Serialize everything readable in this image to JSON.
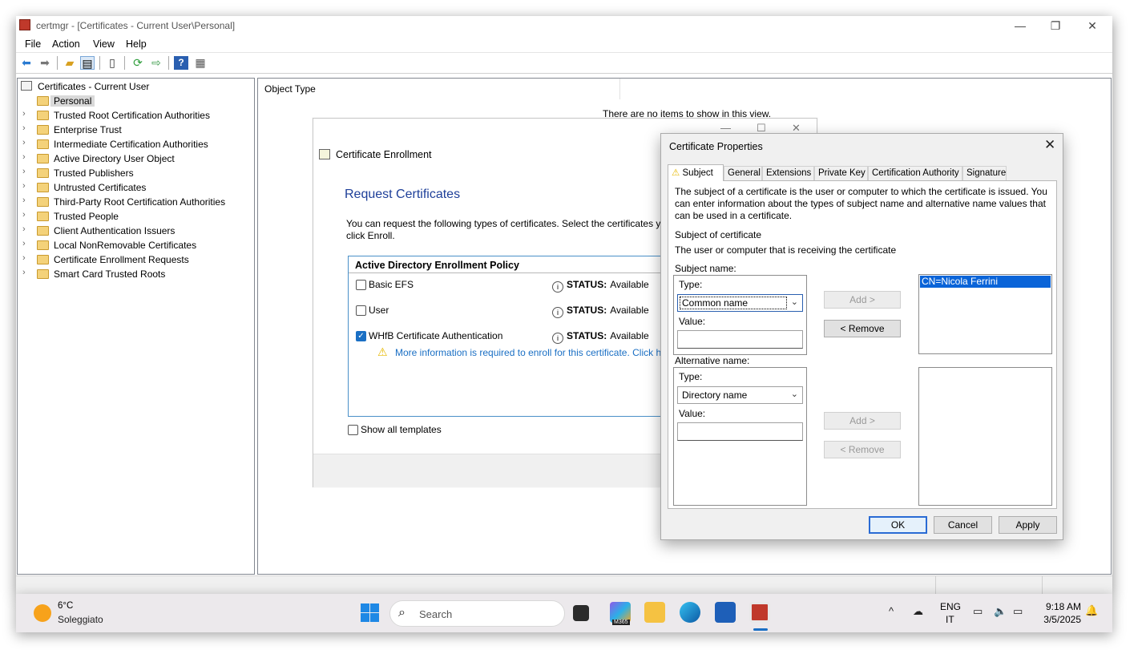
{
  "window": {
    "title": "certmgr - [Certificates - Current User\\Personal]",
    "minimize_glyph": "—",
    "restore_glyph": "❐",
    "close_glyph": "✕"
  },
  "menu": {
    "file": "File",
    "action": "Action",
    "view": "View",
    "help": "Help"
  },
  "toolbar_icons": [
    "back-icon",
    "forward-icon",
    "up-folder-icon",
    "show-hide-tree-icon",
    "clipboard-icon",
    "refresh-icon",
    "export-icon",
    "help-icon",
    "console-tree-icon"
  ],
  "tree": {
    "root": "Certificates - Current User",
    "items": [
      "Personal",
      "Trusted Root Certification Authorities",
      "Enterprise Trust",
      "Intermediate Certification Authorities",
      "Active Directory User Object",
      "Trusted Publishers",
      "Untrusted Certificates",
      "Third-Party Root Certification Authorities",
      "Trusted People",
      "Client Authentication Issuers",
      "Local NonRemovable Certificates",
      "Certificate Enrollment Requests",
      "Smart Card Trusted Roots"
    ]
  },
  "list": {
    "column": "Object Type",
    "empty": "There are no items to show in this view."
  },
  "enroll": {
    "title": "Certificate Enrollment",
    "heading": "Request Certificates",
    "description": "You can request the following types of certificates. Select the certificates yo",
    "description2": "click Enroll.",
    "policy": "Active Directory Enrollment Policy",
    "templates": [
      {
        "name": "Basic EFS",
        "checked": false,
        "status_label": "STATUS:",
        "status": "Available"
      },
      {
        "name": "User",
        "checked": false,
        "status_label": "STATUS:",
        "status": "Available"
      },
      {
        "name": "WHfB Certificate Authentication",
        "checked": true,
        "status_label": "STATUS:",
        "status": "Available"
      }
    ],
    "warning": "More information is required to enroll for this certificate. Click h",
    "show_all": "Show all templates"
  },
  "props": {
    "title": "Certificate Properties",
    "tabs": [
      "Subject",
      "General",
      "Extensions",
      "Private Key",
      "Certification Authority",
      "Signature"
    ],
    "intro": "The subject of a certificate is the user or computer to which the certificate is issued. You can enter information about the types of subject name and alternative name values that can be used in a certificate.",
    "subject_of_cert": "Subject of certificate",
    "subject_desc": "The user or computer that is receiving the certificate",
    "subject_name": "Subject name:",
    "type_label": "Type:",
    "value_label": "Value:",
    "subject_type": "Common name",
    "alt_name": "Alternative name:",
    "alt_type": "Directory name",
    "add_btn": "Add >",
    "remove_btn": "< Remove",
    "subject_list": [
      "CN=Nicola Ferrini"
    ],
    "ok": "OK",
    "cancel": "Cancel",
    "apply": "Apply"
  },
  "taskbar": {
    "temp": "6°C",
    "weather": "Soleggiato",
    "search": "Search",
    "lang1": "ENG",
    "lang2": "IT",
    "time": "9:18 AM",
    "date": "3/5/2025",
    "m365_badge": "M365"
  },
  "colors": {
    "accent": "#1a6fc4",
    "heading": "#1e3f99",
    "selection": "#0a64d8"
  }
}
